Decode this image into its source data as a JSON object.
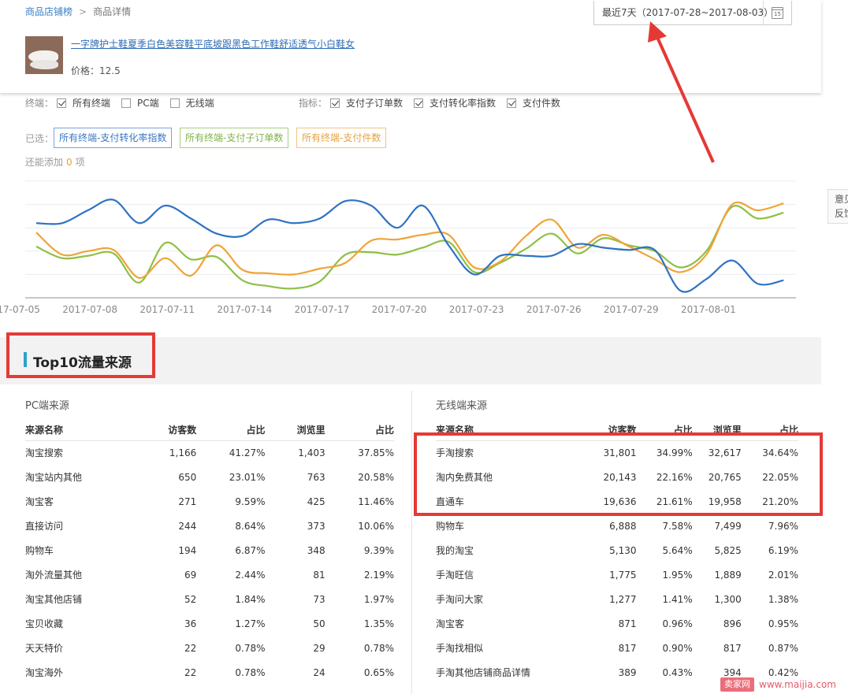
{
  "breadcrumb": {
    "home": "商品店铺榜",
    "sep": ">",
    "current": "商品详情"
  },
  "date_range": {
    "label": "最近7天（2017-07-28~2017-08-03）",
    "calendar_day": "15"
  },
  "product": {
    "title": "一字牌护士鞋夏季白色美容鞋平底坡跟黑色工作鞋舒适透气小白鞋女",
    "price": "价格：12.5"
  },
  "filters": {
    "terminal_label": "终端：",
    "terminals": [
      {
        "label": "所有终端",
        "checked": true
      },
      {
        "label": "PC端",
        "checked": false
      },
      {
        "label": "无线端",
        "checked": false
      }
    ],
    "metric_label": "指标：",
    "metrics": [
      {
        "label": "支付子订单数",
        "checked": true
      },
      {
        "label": "支付转化率指数",
        "checked": true
      },
      {
        "label": "支付件数",
        "checked": true
      }
    ],
    "selected_label": "已选：",
    "selected": [
      "所有终端-支付转化率指数",
      "所有终端-支付子订单数",
      "所有终端-支付件数"
    ],
    "remain_prefix": "还能添加",
    "remain_count": "0",
    "remain_suffix": "项"
  },
  "chart_data": {
    "type": "line",
    "x": [
      "2017-07-05",
      "2017-07-06",
      "2017-07-07",
      "2017-07-08",
      "2017-07-09",
      "2017-07-10",
      "2017-07-11",
      "2017-07-12",
      "2017-07-13",
      "2017-07-14",
      "2017-07-15",
      "2017-07-16",
      "2017-07-17",
      "2017-07-18",
      "2017-07-19",
      "2017-07-20",
      "2017-07-21",
      "2017-07-22",
      "2017-07-23",
      "2017-07-24",
      "2017-07-25",
      "2017-07-26",
      "2017-07-27",
      "2017-07-28",
      "2017-07-29",
      "2017-07-30",
      "2017-07-31",
      "2017-08-01",
      "2017-08-02",
      "2017-08-03"
    ],
    "tick_labels": [
      "2017-07-05",
      "2017-07-08",
      "2017-07-11",
      "2017-07-14",
      "2017-07-17",
      "2017-07-20",
      "2017-07-23",
      "2017-07-26",
      "2017-07-29",
      "2017-08-01"
    ],
    "ylim": [
      0,
      100
    ],
    "grid": true,
    "legend": "none",
    "series": [
      {
        "name": "所有终端-支付转化率指数",
        "color": "#2f72c4",
        "values": [
          64,
          64,
          75,
          84,
          64,
          79,
          68,
          55,
          53,
          67,
          64,
          68,
          83,
          79,
          60,
          79,
          45,
          20,
          36,
          36,
          36,
          46,
          43,
          41,
          41,
          6,
          16,
          32,
          12,
          15
        ]
      },
      {
        "name": "所有终端-支付子订单数",
        "color": "#8dc045",
        "values": [
          44,
          34,
          36,
          38,
          13,
          47,
          33,
          35,
          15,
          10,
          8,
          14,
          37,
          39,
          37,
          43,
          48,
          22,
          30,
          42,
          55,
          38,
          51,
          45,
          40,
          26,
          40,
          78,
          68,
          73
        ]
      },
      {
        "name": "所有终端-支付件数",
        "color": "#f0a336",
        "values": [
          56,
          37,
          40,
          41,
          17,
          34,
          19,
          45,
          24,
          21,
          20,
          25,
          30,
          49,
          50,
          54,
          54,
          26,
          31,
          53,
          67,
          43,
          54,
          44,
          33,
          22,
          37,
          80,
          75,
          81
        ]
      }
    ]
  },
  "section_title": "Top10流量来源",
  "pc_table": {
    "title": "PC端来源",
    "headers": [
      "来源名称",
      "访客数",
      "占比",
      "浏览里",
      "占比"
    ],
    "rows": [
      [
        "淘宝搜索",
        "1,166",
        "41.27%",
        "1,403",
        "37.85%"
      ],
      [
        "淘宝站内其他",
        "650",
        "23.01%",
        "763",
        "20.58%"
      ],
      [
        "淘宝客",
        "271",
        "9.59%",
        "425",
        "11.46%"
      ],
      [
        "直接访问",
        "244",
        "8.64%",
        "373",
        "10.06%"
      ],
      [
        "购物车",
        "194",
        "6.87%",
        "348",
        "9.39%"
      ],
      [
        "淘外流量其他",
        "69",
        "2.44%",
        "81",
        "2.19%"
      ],
      [
        "淘宝其他店铺",
        "52",
        "1.84%",
        "73",
        "1.97%"
      ],
      [
        "宝贝收藏",
        "36",
        "1.27%",
        "50",
        "1.35%"
      ],
      [
        "天天特价",
        "22",
        "0.78%",
        "29",
        "0.78%"
      ],
      [
        "淘宝海外",
        "22",
        "0.78%",
        "24",
        "0.65%"
      ]
    ]
  },
  "mobile_table": {
    "title": "无线端来源",
    "headers": [
      "来源名称",
      "访客数",
      "占比",
      "浏览里",
      "占比"
    ],
    "rows": [
      [
        "手淘搜索",
        "31,801",
        "34.99%",
        "32,617",
        "34.64%"
      ],
      [
        "淘内免费其他",
        "20,143",
        "22.16%",
        "20,765",
        "22.05%"
      ],
      [
        "直通车",
        "19,636",
        "21.61%",
        "19,958",
        "21.20%"
      ],
      [
        "购物车",
        "6,888",
        "7.58%",
        "7,499",
        "7.96%"
      ],
      [
        "我的淘宝",
        "5,130",
        "5.64%",
        "5,825",
        "6.19%"
      ],
      [
        "手淘旺信",
        "1,775",
        "1.95%",
        "1,889",
        "2.01%"
      ],
      [
        "手淘问大家",
        "1,277",
        "1.41%",
        "1,300",
        "1.38%"
      ],
      [
        "淘宝客",
        "871",
        "0.96%",
        "896",
        "0.95%"
      ],
      [
        "手淘找相似",
        "817",
        "0.90%",
        "817",
        "0.87%"
      ],
      [
        "手淘其他店铺商品详情",
        "389",
        "0.43%",
        "394",
        "0.42%"
      ]
    ]
  },
  "side_tab": {
    "line1": "意见",
    "line2": "反馈"
  },
  "watermark": {
    "logo": "卖家网",
    "url": "www.maijia.com"
  },
  "colors": {
    "annotation_red": "#e53935",
    "link_blue": "#2f6db5"
  }
}
